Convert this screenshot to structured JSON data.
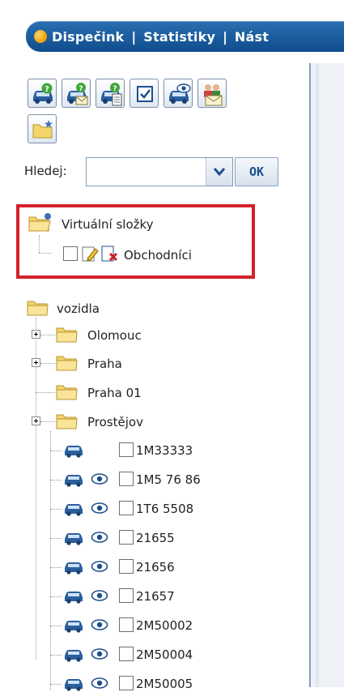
{
  "nav": {
    "links": [
      "Dispečink",
      "Statistiky",
      "Nást"
    ],
    "separator": "|"
  },
  "toolbar": {
    "buttons": [
      {
        "name": "car-question-icon"
      },
      {
        "name": "car-question-mail-icon"
      },
      {
        "name": "car-question-document-icon"
      },
      {
        "name": "checkbox-icon"
      },
      {
        "name": "car-eye-icon"
      },
      {
        "name": "people-mail-icon"
      },
      {
        "name": "new-folder-icon"
      }
    ]
  },
  "search": {
    "label": "Hledej:",
    "value": "",
    "ok_label": "OK"
  },
  "virtual_folders": {
    "title": "Virtuální složky",
    "items": [
      {
        "label": "Obchodníci"
      }
    ]
  },
  "tree": {
    "root": "vozidla",
    "folders": [
      {
        "label": "Olomouc",
        "expandable": true
      },
      {
        "label": "Praha",
        "expandable": true
      },
      {
        "label": "Praha 01",
        "expandable": false
      },
      {
        "label": "Prostějov",
        "expandable": true
      }
    ],
    "vehicles": [
      {
        "label": "1M33333",
        "tracked": false
      },
      {
        "label": "1M5 76 86",
        "tracked": true
      },
      {
        "label": "1T6 5508",
        "tracked": true
      },
      {
        "label": "21655",
        "tracked": true
      },
      {
        "label": "21656",
        "tracked": true
      },
      {
        "label": "21657",
        "tracked": true
      },
      {
        "label": "2M50002",
        "tracked": true
      },
      {
        "label": "2M50004",
        "tracked": true
      },
      {
        "label": "2M50005",
        "tracked": true
      }
    ]
  },
  "colors": {
    "nav_bar": "#1a5c9e",
    "highlight": "#d4202a",
    "folder": "#f4d56a",
    "car": "#2a5f9e"
  }
}
